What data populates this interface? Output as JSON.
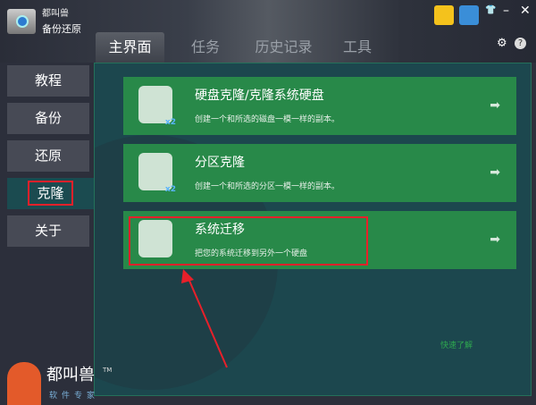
{
  "header": {
    "brand": "都叫兽",
    "app_name": "备份还原",
    "tabs": [
      "主界面",
      "任务",
      "历史记录",
      "工具"
    ],
    "active_tab": 0
  },
  "sidebar": {
    "items": [
      {
        "label": "教程"
      },
      {
        "label": "备份"
      },
      {
        "label": "还原"
      },
      {
        "label": "克隆"
      },
      {
        "label": "关于"
      }
    ],
    "active": 3
  },
  "cards": [
    {
      "title": "硬盘克隆/克隆系统硬盘",
      "desc": "创建一个和所选的磁盘一模一样的副本。",
      "badge": "x2",
      "icon": "hard-disk-icon"
    },
    {
      "title": "分区克隆",
      "desc": "创建一个和所选的分区一模一样的副本。",
      "badge": "x2",
      "icon": "folder-icon"
    },
    {
      "title": "系统迁移",
      "desc": "把您的系统迁移到另外一个硬盘",
      "icon": "windows-icon"
    }
  ],
  "quick_link": "快速了解",
  "footer": {
    "brand": "都叫兽",
    "tm": "TM",
    "subtitle": "软件专家"
  },
  "colors": {
    "card": "#288949",
    "panel": "#1c474e",
    "highlight": "#e8202a"
  }
}
